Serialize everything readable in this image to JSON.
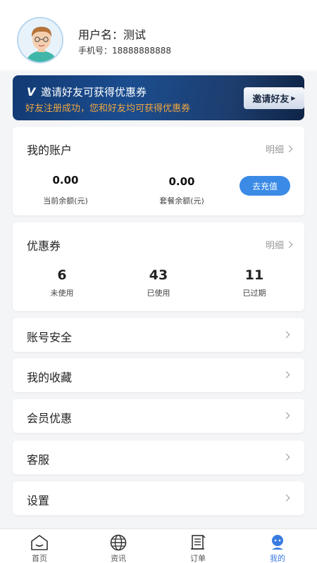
{
  "profile": {
    "username": "用户名：测试",
    "phone": "手机号：18888888888"
  },
  "banner": {
    "check_mark": "V",
    "title": "邀请好友可获得优惠券",
    "subtitle": "好友注册成功，您和好友均可获得优惠券",
    "button_label": "邀请好友"
  },
  "account": {
    "title": "我的账户",
    "detail_link": "明细",
    "current_balance_value": "0.00",
    "current_balance_label": "当前余额(元)",
    "package_balance_value": "0.00",
    "package_balance_label": "套餐余额(元)",
    "recharge_button": "去充值"
  },
  "coupons": {
    "title": "优惠券",
    "detail_link": "明细",
    "unused_value": "6",
    "unused_label": "未使用",
    "used_value": "43",
    "used_label": "已使用",
    "expired_value": "11",
    "expired_label": "已过期"
  },
  "menu": [
    {
      "label": "账号安全"
    },
    {
      "label": "我的收藏"
    },
    {
      "label": "会员优惠"
    },
    {
      "label": "客服"
    },
    {
      "label": "设置"
    }
  ],
  "tabs": [
    {
      "label": "首页",
      "icon": "home-icon"
    },
    {
      "label": "资讯",
      "icon": "globe-icon"
    },
    {
      "label": "订单",
      "icon": "order-icon"
    },
    {
      "label": "我的",
      "icon": "profile-icon"
    }
  ],
  "colors": {
    "accent": "#3a8ae6",
    "banner_bg": "#1b4d8f",
    "banner_subtitle": "#f0a640",
    "active_tab": "#3a7be0"
  },
  "active_tab": "我的"
}
